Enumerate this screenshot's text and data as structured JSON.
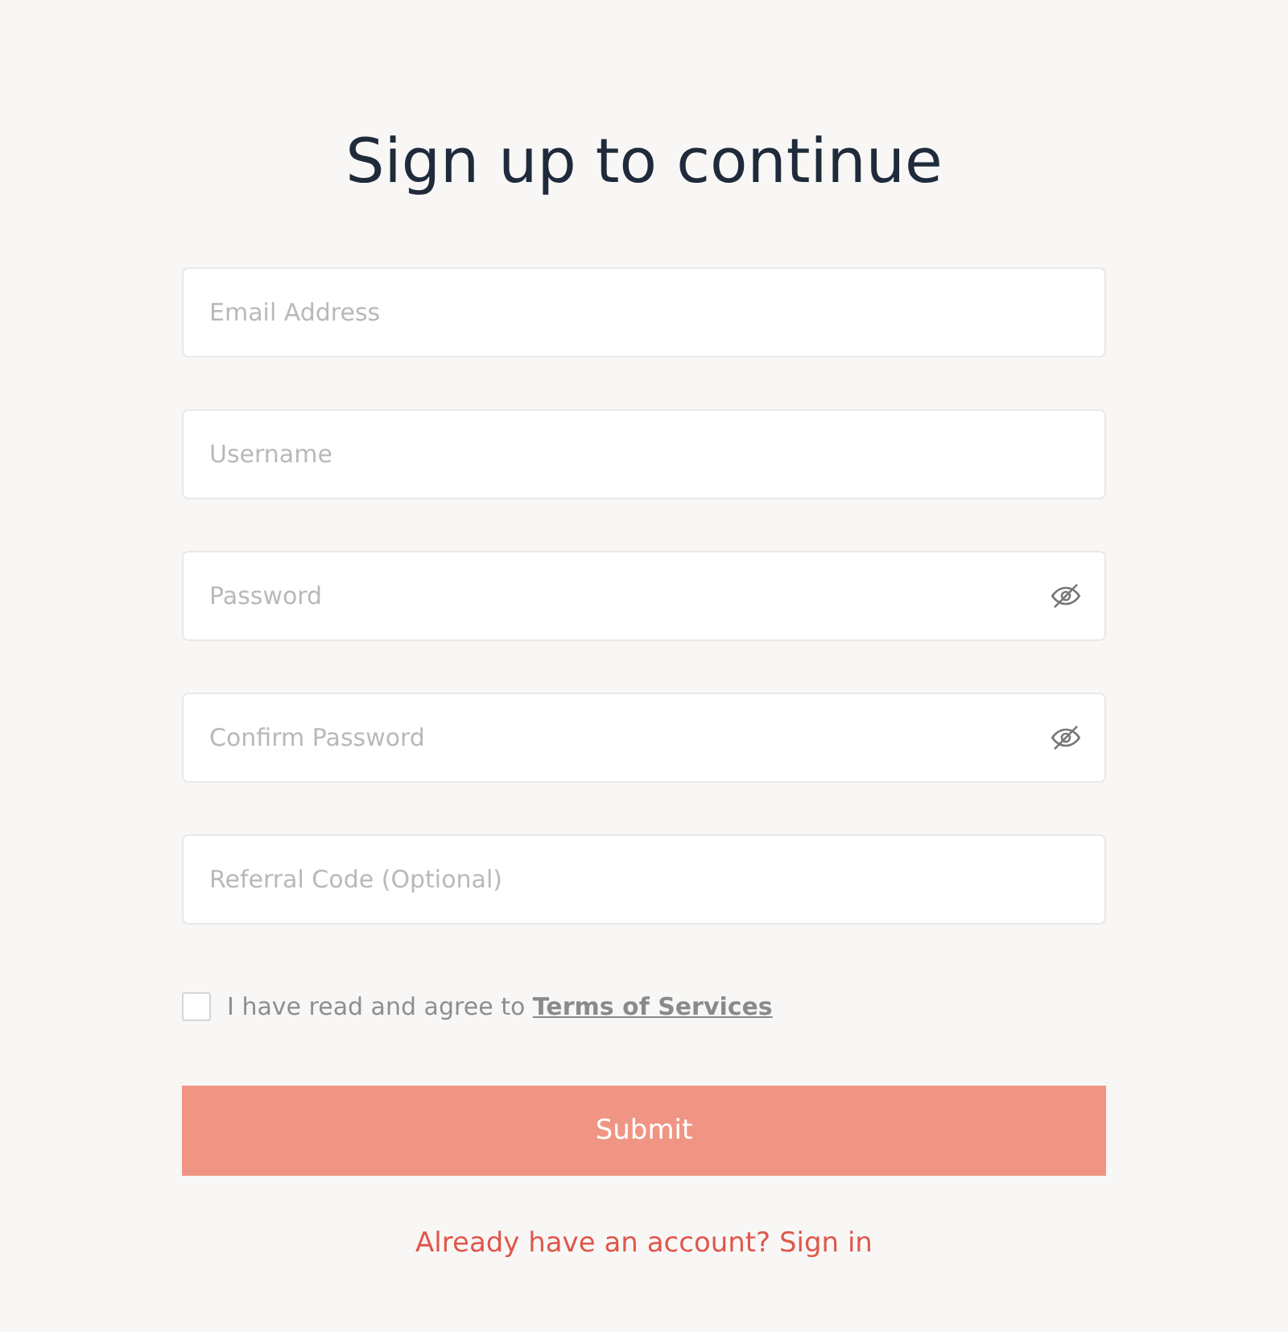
{
  "title": "Sign up to continue",
  "fields": [
    {
      "kind": "text",
      "placeholder": "Email Address"
    },
    {
      "kind": "text",
      "placeholder": "Username"
    },
    {
      "kind": "password",
      "placeholder": "Password"
    },
    {
      "kind": "password",
      "placeholder": "Confirm Password"
    },
    {
      "kind": "text",
      "placeholder": "Referral Code (Optional)"
    }
  ],
  "agreement": {
    "checked": false,
    "text": "I have read and agree to",
    "link": "Terms of Services"
  },
  "submit": "Submit",
  "signin_link": "Already have an account? Sign in"
}
